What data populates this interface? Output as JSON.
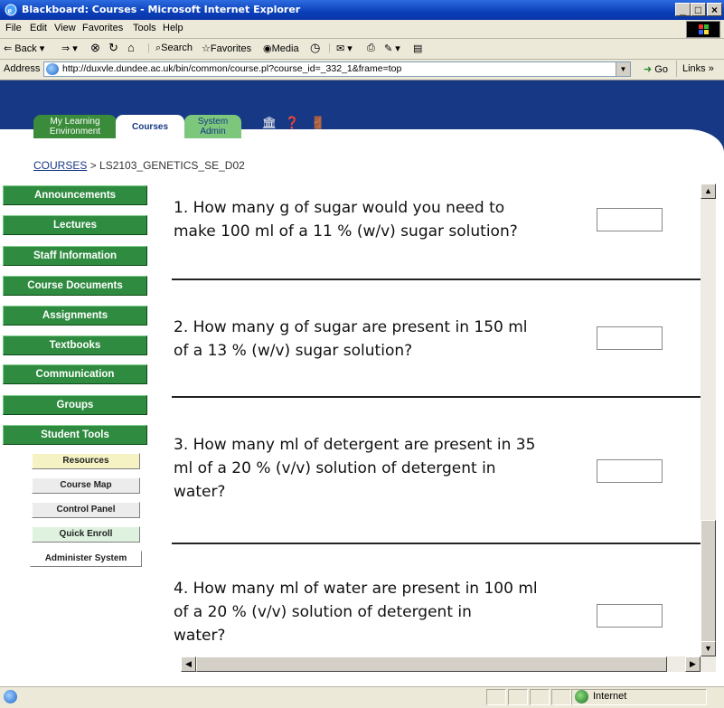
{
  "window": {
    "title": "Blackboard: Courses - Microsoft Internet Explorer",
    "minimize": "_",
    "maximize": "□",
    "close": "×"
  },
  "menu": [
    "File",
    "Edit",
    "View",
    "Favorites",
    "Tools",
    "Help"
  ],
  "toolbar": {
    "back": "⇐ Back",
    "forward": "⇒",
    "search": "Search",
    "favorites": "Favorites",
    "media": "Media"
  },
  "address": {
    "label": "Address",
    "url": "http://duxvle.dundee.ac.uk/bin/common/course.pl?course_id=_332_1&frame=top",
    "go": "Go",
    "links": "Links »"
  },
  "bb": {
    "tabs": {
      "my_learning": "My Learning Environment",
      "courses": "Courses",
      "system_admin": "System Admin"
    },
    "icons": {
      "home": "Home",
      "help": "Help",
      "logout": "Logout"
    },
    "breadcrumb": {
      "link": "COURSES",
      "separator": " > ",
      "current": "LS2103_GENETICS_SE_D02"
    }
  },
  "sidebar": {
    "items": [
      "Announcements",
      "Lectures",
      "Staff Information",
      "Course Documents",
      "Assignments",
      "Textbooks",
      "Communication",
      "Groups",
      "Student Tools"
    ],
    "tools": [
      "Resources",
      "Course Map",
      "Control Panel",
      "Quick Enroll",
      "Administer System"
    ]
  },
  "questions": [
    {
      "lines": [
        "1. How many g of sugar would you need to",
        "make 100 ml of a 11 % (w/v) sugar solution?"
      ],
      "answer": ""
    },
    {
      "lines": [
        "2. How many g of sugar are present in 150 ml",
        "of a 13 % (w/v) sugar solution?"
      ],
      "answer": ""
    },
    {
      "lines": [
        "3. How many ml of detergent are present in 35",
        "ml of a 20 % (v/v) solution of detergent in",
        "water?"
      ],
      "answer": ""
    },
    {
      "lines": [
        "4. How many ml of water are present in 100 ml",
        "of a 20 % (v/v) solution of detergent in",
        "water?"
      ],
      "answer": ""
    }
  ],
  "status": {
    "zone": "Internet"
  }
}
